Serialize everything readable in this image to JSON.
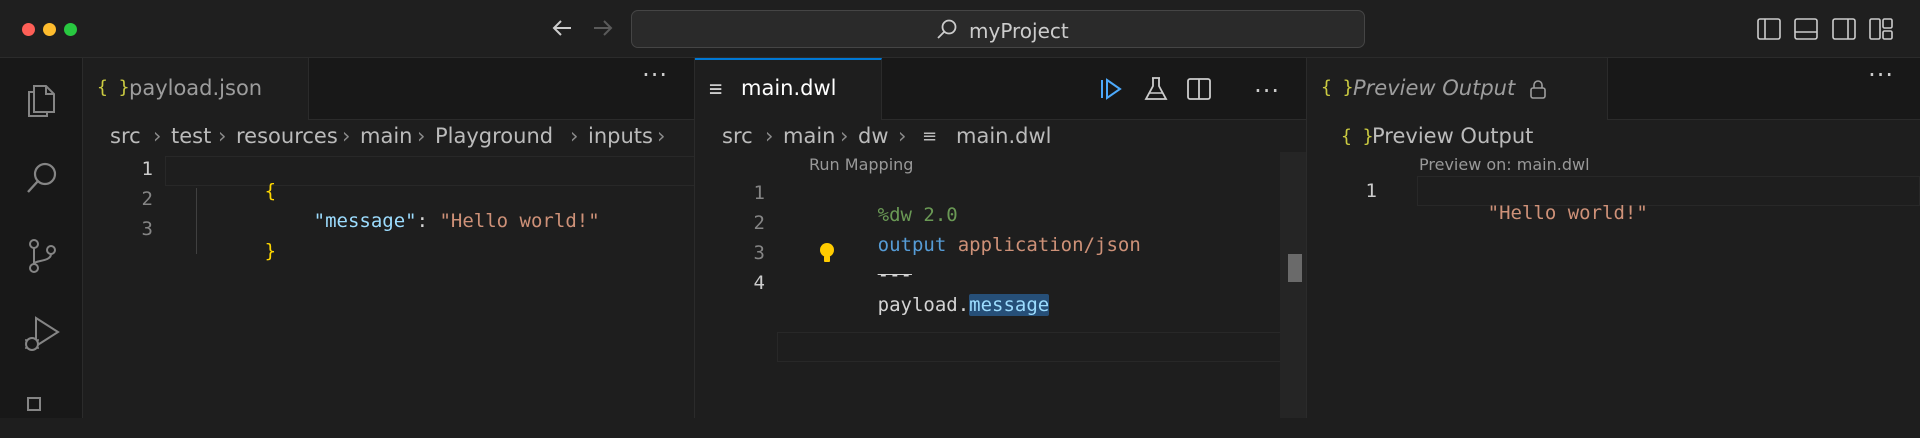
{
  "window": {
    "title": "myProject"
  },
  "icons": {
    "back": "arrow-left-icon",
    "forward": "arrow-right-icon",
    "search": "search-icon",
    "explorer": "files-icon",
    "activity_search": "search-icon",
    "source_control": "source-control-icon",
    "run_debug": "run-debug-icon",
    "run_mapping": "run-icon",
    "test": "beaker-icon",
    "split": "split-editor-icon",
    "lock": "lock-icon",
    "lightbulb": "lightbulb-icon"
  },
  "colors": {
    "accent": "#0078d4",
    "brace": "#ffd700",
    "string": "#ce9178",
    "key": "#9cdcfe",
    "keyword": "#569cd6",
    "directive": "#6a9955"
  },
  "editors": {
    "left": {
      "tab": {
        "icon": "{ }",
        "label": "payload.json"
      },
      "more": "···",
      "breadcrumb": [
        "src",
        "test",
        "resources",
        "main",
        "Playground",
        "inputs"
      ],
      "line_numbers": [
        "1",
        "2",
        "3"
      ],
      "code": {
        "l1_brace": "{",
        "l2_key": "\"message\"",
        "l2_colon": ": ",
        "l2_value": "\"Hello world!\"",
        "l3_brace": "}"
      }
    },
    "middle": {
      "tab": {
        "icon": "≡",
        "label": "main.dwl"
      },
      "more": "···",
      "breadcrumb": [
        "src",
        "main",
        "dw",
        "main.dwl"
      ],
      "codelens": "Run Mapping",
      "line_numbers": [
        "1",
        "2",
        "3",
        "4"
      ],
      "code": {
        "l1": "%dw 2.0",
        "l2_kw": "output",
        "l2_val": "application/json",
        "l3": "---",
        "l4_obj": "payload",
        "l4_dot": ".",
        "l4_field": "message"
      }
    },
    "right": {
      "tab": {
        "icon": "{ }",
        "label": "Preview Output"
      },
      "more": "···",
      "breadcrumb_icon": "{ }",
      "breadcrumb": "Preview Output",
      "codelens": "Preview on: main.dwl",
      "line_numbers": [
        "1"
      ],
      "code": {
        "l1": "\"Hello world!\""
      }
    }
  }
}
